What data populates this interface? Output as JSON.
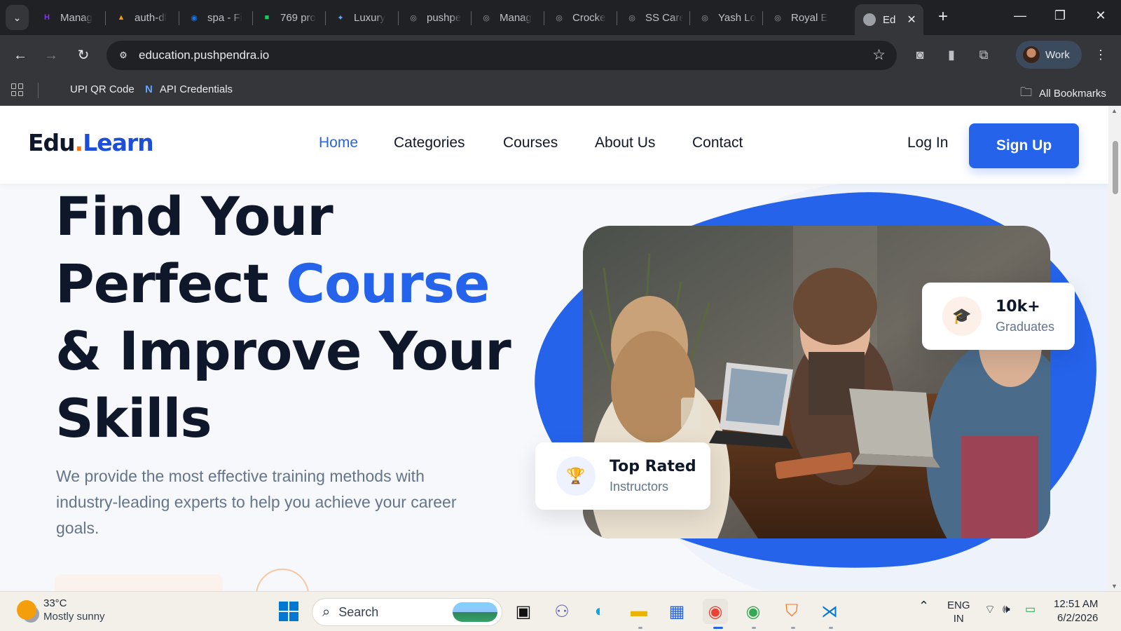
{
  "browser": {
    "tabs": [
      {
        "label": "Manag",
        "favicon": "H",
        "favicon_color": "#7c3aed"
      },
      {
        "label": "auth-dl",
        "favicon": "▲",
        "favicon_color": "#f59e0b"
      },
      {
        "label": "spa - Fi",
        "favicon": "◉",
        "favicon_color": "#1a73e8"
      },
      {
        "label": "769 pro",
        "favicon": "■",
        "favicon_color": "#22c55e"
      },
      {
        "label": "Luxury",
        "favicon": "✦",
        "favicon_color": "#60a5fa"
      },
      {
        "label": "pushpe",
        "favicon": "◎",
        "favicon_color": "#9aa0a6"
      },
      {
        "label": "Manag",
        "favicon": "◎",
        "favicon_color": "#9aa0a6"
      },
      {
        "label": "Crocke",
        "favicon": "◎",
        "favicon_color": "#9aa0a6"
      },
      {
        "label": "SS Care",
        "favicon": "◎",
        "favicon_color": "#9aa0a6"
      },
      {
        "label": "Yash Lo",
        "favicon": "◎",
        "favicon_color": "#9aa0a6"
      },
      {
        "label": "Royal E",
        "favicon": "◎",
        "favicon_color": "#9aa0a6"
      }
    ],
    "active_tab": {
      "label": "Ed"
    },
    "url": "education.pushpendra.io",
    "profile_label": "Work",
    "bookmarks": [
      {
        "label": "UPI QR Code"
      },
      {
        "label": "API Credentials"
      }
    ],
    "all_bookmarks_label": "All Bookmarks"
  },
  "site": {
    "logo": {
      "part1": "Edu",
      "dot": ".",
      "part2": "Learn"
    },
    "nav": [
      "Home",
      "Categories",
      "Courses",
      "About Us",
      "Contact"
    ],
    "active_nav": "Home",
    "login_label": "Log In",
    "signup_label": "Sign Up",
    "hero": {
      "line1": "Find Your",
      "line2a": "Perfect ",
      "line2b": "Course",
      "line3": "& Improve Your",
      "line4": "Skills",
      "subtitle": "We provide the most effective training methods with industry-leading experts to help you achieve your career goals."
    },
    "stat_card": {
      "value": "10k+",
      "label": "Graduates",
      "icon": "graduation-cap"
    },
    "rated_card": {
      "value": "Top Rated",
      "label": "Instructors",
      "icon": "trophy"
    },
    "colors": {
      "brand": "#2563eb",
      "accent": "#f97316",
      "dark": "#0f172a"
    }
  },
  "taskbar": {
    "weather": {
      "temp": "33°C",
      "condition": "Mostly sunny"
    },
    "search_placeholder": "Search",
    "lang_top": "ENG",
    "lang_bottom": "IN",
    "time": "12:51 AM",
    "date": "6/2/2026"
  }
}
